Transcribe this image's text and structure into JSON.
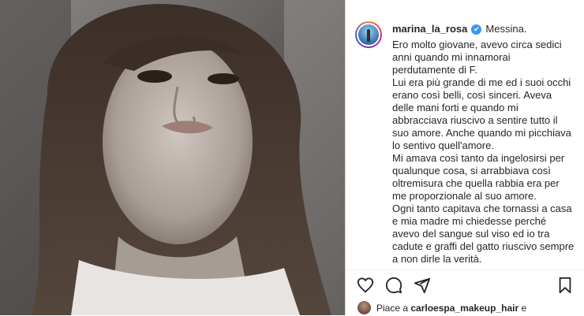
{
  "post": {
    "username": "marina_la_rosa",
    "verified_icon": "verified-badge-icon",
    "location": "Messina.",
    "caption_paragraphs": [
      "Ero molto giovane, avevo circa sedici anni quando mi innamorai perdutamente di F.",
      "Lui era più grande di me ed i suoi occhi erano così belli, così sinceri. Aveva delle mani forti e quando mi abbracciava riuscivo a sentire tutto il suo amore. Anche quando mi picchiava lo sentivo quell'amore.",
      "Mi amava così tanto da ingelosirsi per qualunque cosa, si arrabbiava così oltremisura che quella rabbia era per me proporzionale al suo amore.",
      "Ogni tanto capitava che tornassi a casa e mia madre mi chiedesse perché avevo del sangue sul viso ed io tra cadute e graffi del gatto riuscivo sempre a non dirle la verità."
    ],
    "likes_prefix": "Piace a",
    "likes_user": "carloespa_makeup_hair",
    "likes_suffix": "e"
  },
  "icons": {
    "like": "heart-icon",
    "comment": "comment-icon",
    "share": "share-icon",
    "save": "bookmark-icon"
  },
  "colors": {
    "text": "#262626",
    "verified": "#3897f0",
    "border": "#dbdbdb"
  }
}
